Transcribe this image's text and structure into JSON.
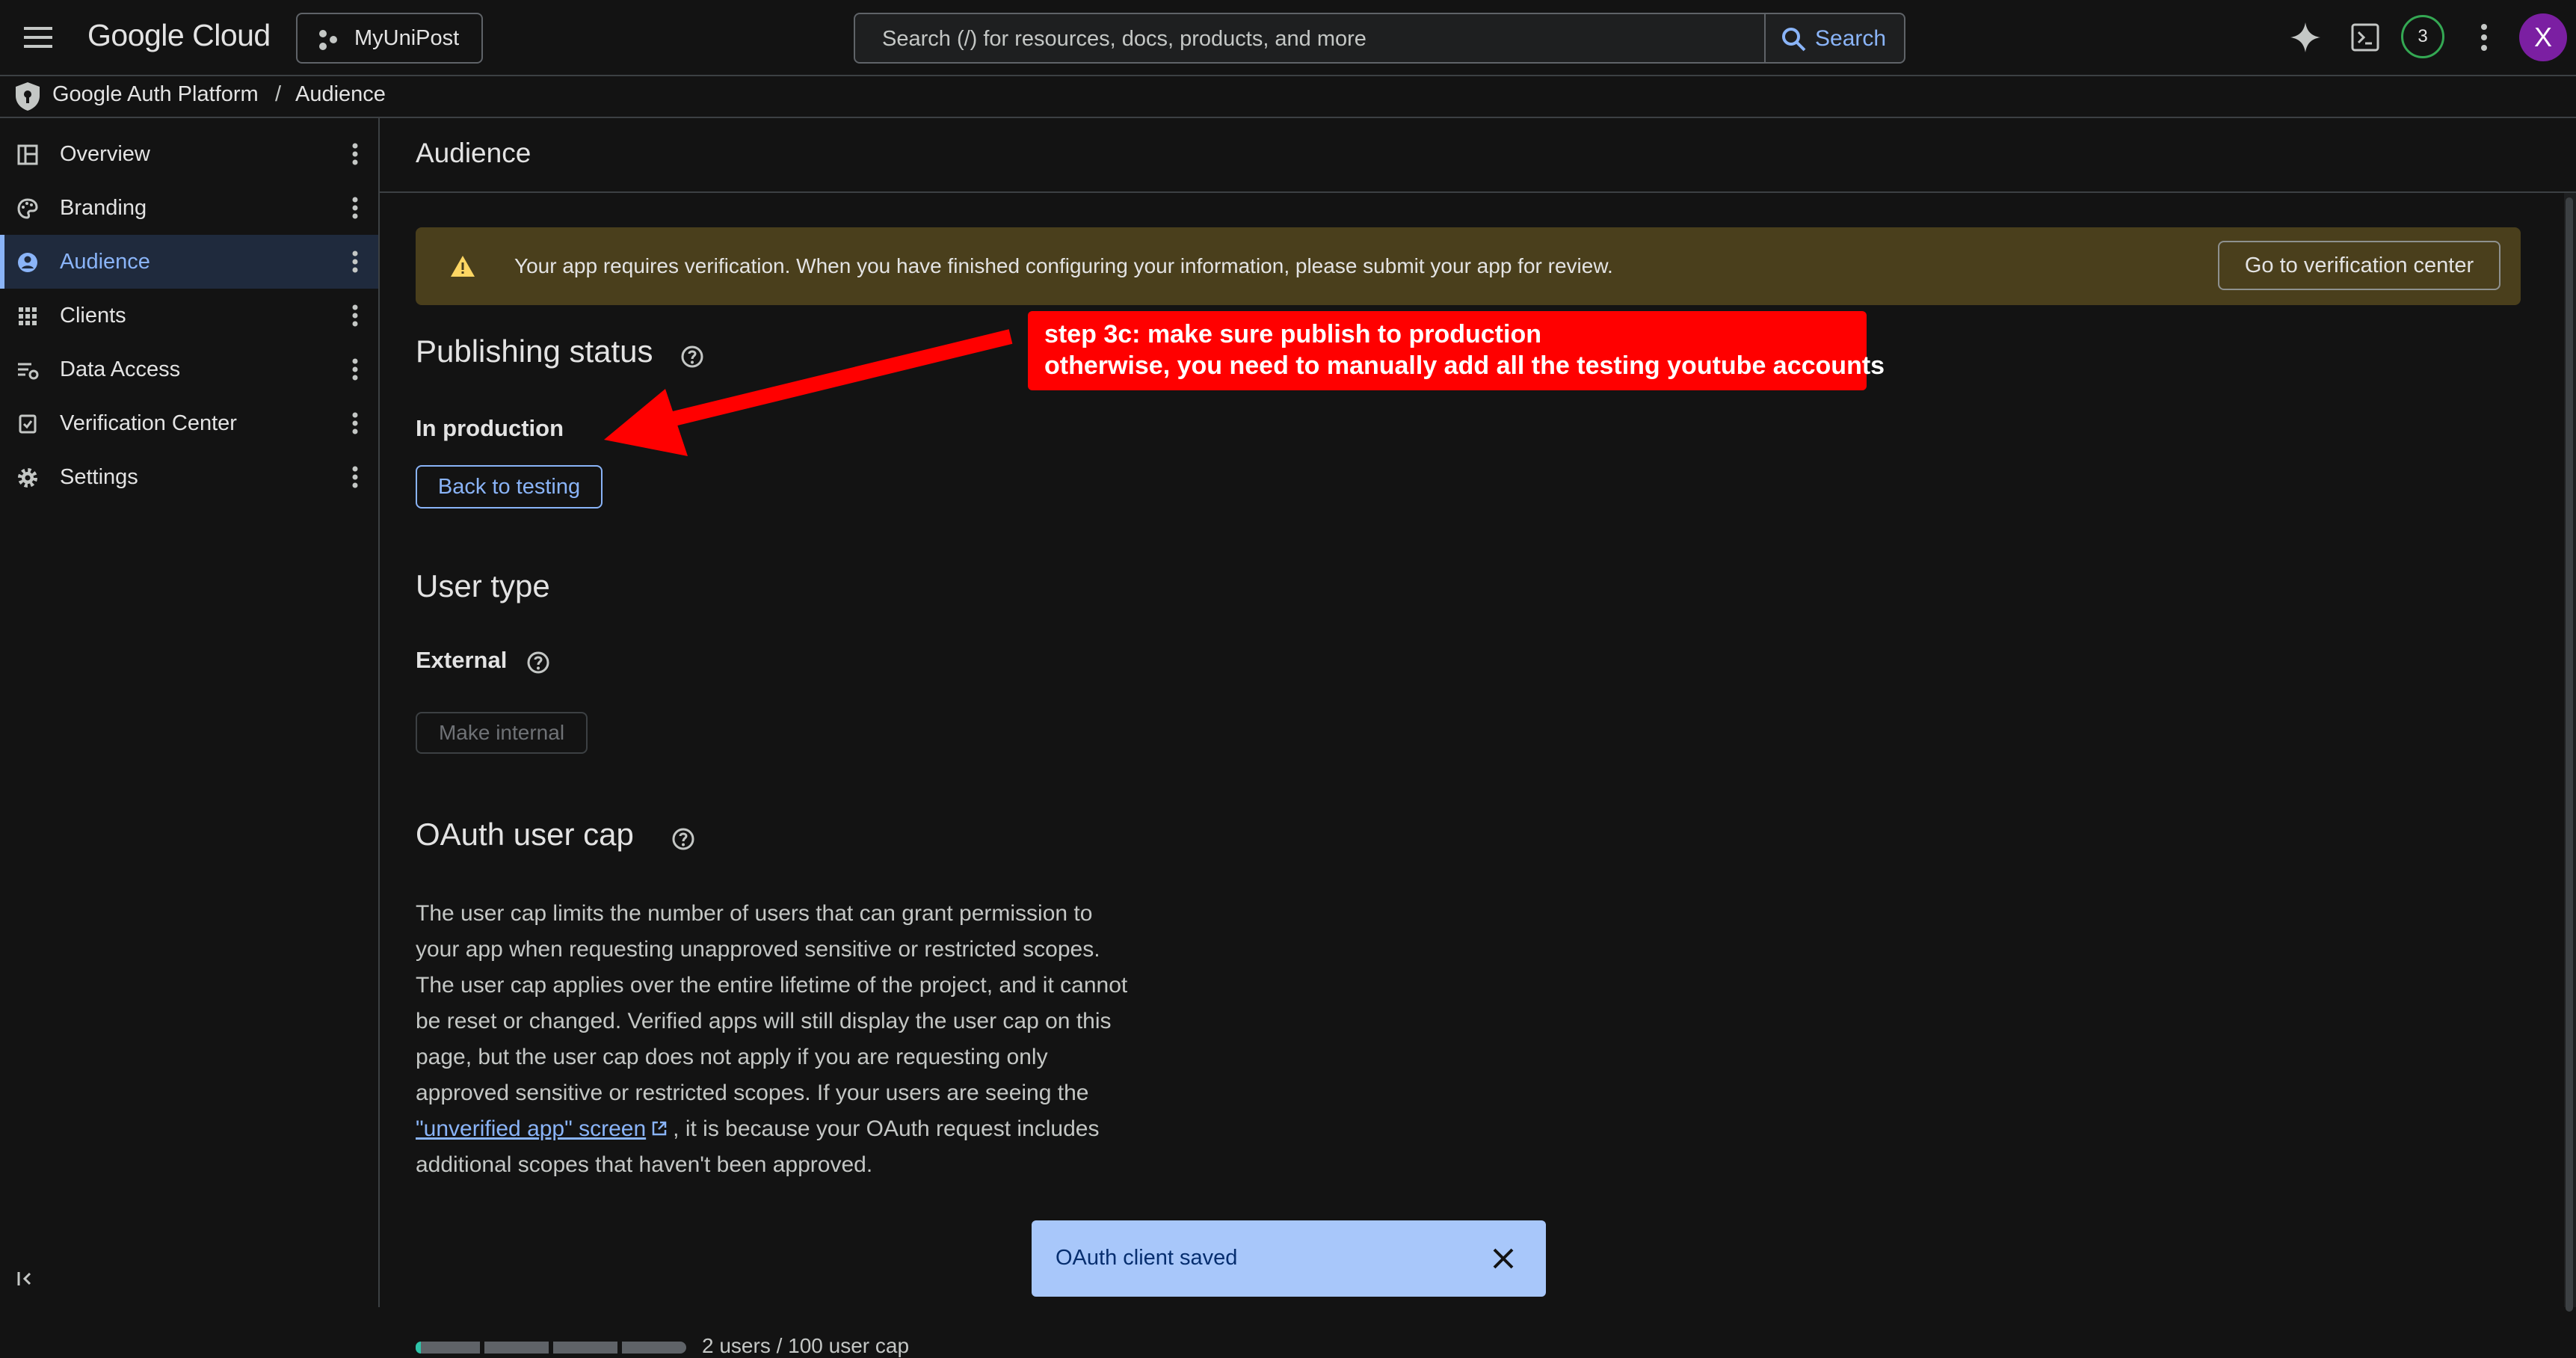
{
  "header": {
    "brand": "Google Cloud",
    "project": "MyUniPost",
    "search_placeholder": "Search (/) for resources, docs, products, and more",
    "search_button": "Search",
    "notification_count": "3",
    "avatar_letter": "X"
  },
  "breadcrumb": {
    "root": "Google Auth Platform",
    "separator": "/",
    "current": "Audience"
  },
  "sidebar": {
    "items": [
      {
        "label": "Overview",
        "icon": "dashboard-icon"
      },
      {
        "label": "Branding",
        "icon": "palette-icon"
      },
      {
        "label": "Audience",
        "icon": "account-circle-icon"
      },
      {
        "label": "Clients",
        "icon": "apps-grid-icon"
      },
      {
        "label": "Data Access",
        "icon": "data-access-icon"
      },
      {
        "label": "Verification Center",
        "icon": "verified-check-icon"
      },
      {
        "label": "Settings",
        "icon": "gear-icon"
      }
    ],
    "active_index": 2
  },
  "page": {
    "title": "Audience",
    "banner": {
      "text": "Your app requires verification. When you have finished configuring your information, please submit your app for review.",
      "button": "Go to verification center"
    },
    "publishing": {
      "title": "Publishing status",
      "status": "In production",
      "button": "Back to testing"
    },
    "user_type": {
      "title": "User type",
      "value": "External",
      "button": "Make internal"
    },
    "oauth_cap": {
      "title": "OAuth user cap",
      "paragraph_lines": [
        "The user cap limits the number of users that can grant permission to",
        "your app when requesting unapproved sensitive or restricted scopes.",
        "The user cap applies over the entire lifetime of the project, and it cannot",
        "be reset or changed. Verified apps will still display the user cap on this",
        "page, but the user cap does not apply if you are requesting only",
        "approved sensitive or restricted scopes. If your users are seeing the"
      ],
      "link_text": "\"unverified app\" screen",
      "after_link": ", it is because your OAuth request includes",
      "last_line": "additional scopes that haven't been approved.",
      "usage_text": "2 users / 100 user cap",
      "usage_fraction": 0.02
    }
  },
  "annotation": {
    "line1": "step 3c: make sure publish to production",
    "line2": "otherwise, you need to manually add all the testing youtube accounts"
  },
  "toast": {
    "text": "OAuth client saved"
  },
  "colors": {
    "accent": "#8ab4f8",
    "banner_bg": "#4a3f1c",
    "warning": "#fdd663",
    "annotation_red": "#ff0000",
    "toast_bg": "#a8c7fa",
    "progress_fill": "#2ec4a9"
  }
}
